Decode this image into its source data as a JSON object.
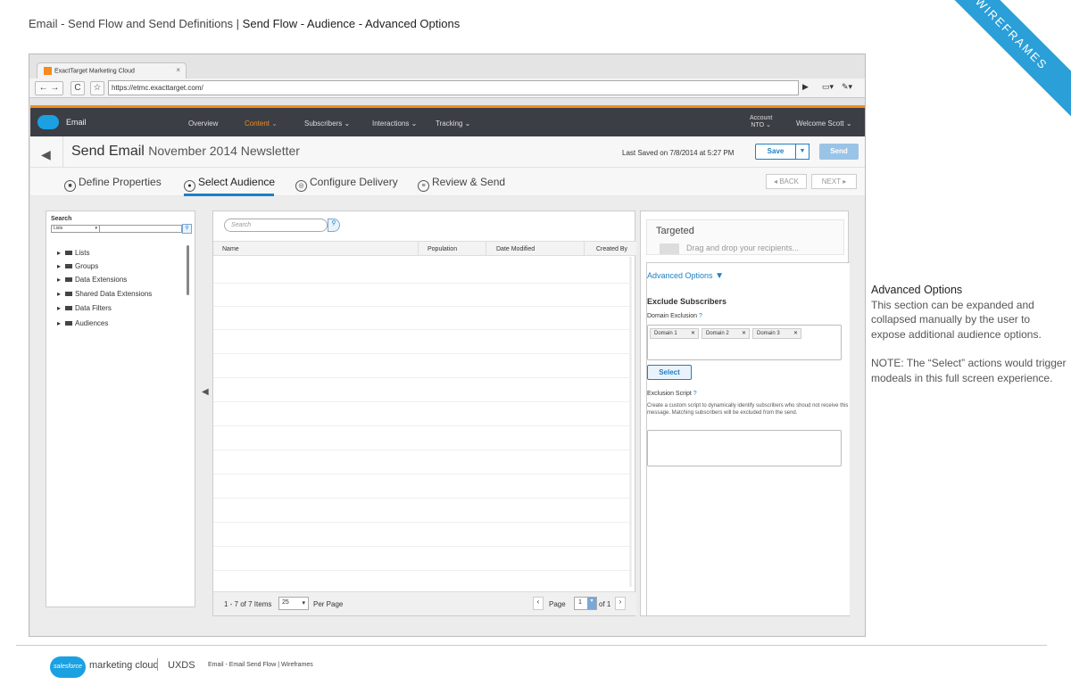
{
  "page": {
    "title_prefix": "Email - Send Flow and Send Definitions | ",
    "title_main": "Send Flow - Audience - Advanced Options",
    "ribbon": "WIREFRAMES"
  },
  "browser": {
    "tab_title": "ExactTarget Marketing Cloud",
    "url": "https://etmc.exacttarget.com/"
  },
  "app_nav": {
    "app_name": "Email",
    "items": [
      "Overview",
      "Content",
      "Subscribers",
      "Interactions",
      "Tracking"
    ],
    "active": "Content",
    "account_label": "Account",
    "account_value": "NTO",
    "welcome": "Welcome  Scott"
  },
  "header": {
    "title": "Send Email",
    "subtitle": "November 2014 Newsletter",
    "last_saved": "Last Saved on 7/8/2014 at 5:27 PM",
    "save": "Save",
    "send": "Send"
  },
  "steps": {
    "items": [
      "Define Properties",
      "Select Audience",
      "Configure Delivery",
      "Review & Send"
    ],
    "active": "Select Audience",
    "back": "◂ BACK",
    "next": "NEXT ▸"
  },
  "left_panel": {
    "search_label": "Search",
    "select_value": "Lists",
    "tree": [
      "Lists",
      "Groups",
      "Data Extensions",
      "Shared Data Extensions",
      "Data Filters",
      "Audiences"
    ]
  },
  "grid": {
    "search_placeholder": "Search",
    "columns": [
      "Name",
      "Population",
      "Date Modified",
      "Created By"
    ],
    "items_text": "1 - 7 of 7 Items",
    "per_page_value": "25",
    "per_page_label": "Per Page",
    "page_label": "Page",
    "page_value": "1",
    "of_label": "of 1"
  },
  "right_panel": {
    "targeted_title": "Targeted",
    "drag_hint": "Drag and drop your recipients...",
    "advanced_options": "Advanced Options",
    "exclude_title": "Exclude Subscribers",
    "domain_label": "Domain Exclusion",
    "domains": [
      "Domain 1",
      "Domain 2",
      "Domain 3"
    ],
    "select": "Select",
    "script_label": "Exclusion Script",
    "script_help": "Create a custom script to dynamically identify subscribers who shoud not receive this message. Matching subscribers will be excluded from the send."
  },
  "annotation": {
    "title": "Advanced Options",
    "body": "This section can be expanded and collapsed manually by the user to expose additional audience options.",
    "note": "NOTE: The “Select” actions would trigger modeals in this full screen experience."
  },
  "footer": {
    "logo": "salesforce",
    "brand": "marketing cloud",
    "uxds": "UXDS",
    "crumb": "Email - Email Send Flow  |  Wireframes"
  }
}
